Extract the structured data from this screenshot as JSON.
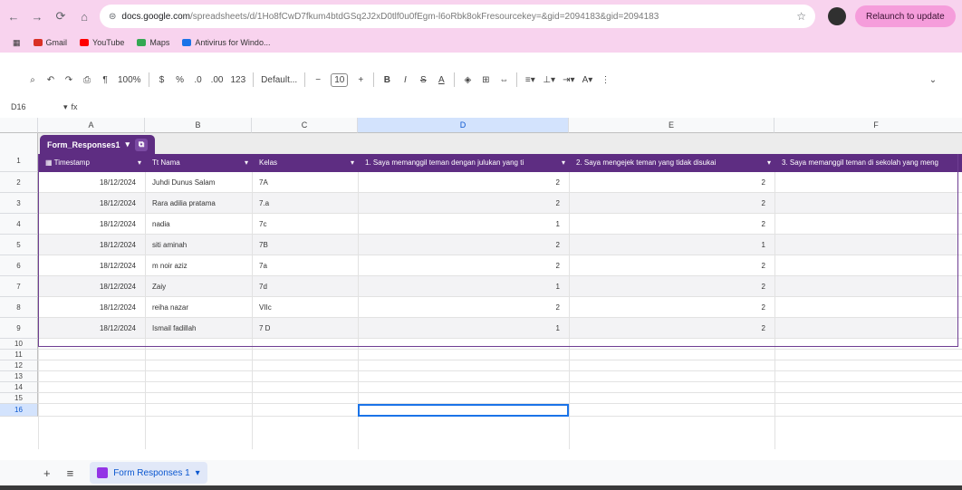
{
  "browser": {
    "url_domain": "docs.google.com",
    "url_path": "/spreadsheets/d/1Ho8fCwD7fkum4btdGSq2J2xD0tlf0u0fEgm-l6oRbk8okFresourcekey=&gid=2094183&gid=2094183",
    "relaunch_label": "Relaunch to update",
    "bookmarks": [
      {
        "label": "Gmail",
        "color": "#d93025"
      },
      {
        "label": "YouTube",
        "color": "#ff0000"
      },
      {
        "label": "Maps",
        "color": "#34a853"
      },
      {
        "label": "Antivirus for Windo...",
        "color": "#1a73e8"
      }
    ]
  },
  "toolbar": {
    "zoom": "100%",
    "font": "Default...",
    "font_size": "10",
    "bold": "B",
    "italic": "I",
    "strike": "S",
    "underline_a": "A",
    "collapse": "⌄"
  },
  "formula_bar": {
    "name_box": "D16",
    "fx": "fx"
  },
  "columns": [
    "A",
    "B",
    "C",
    "D",
    "E",
    "F"
  ],
  "selected_column": "D",
  "row_numbers": [
    "1",
    "2",
    "3",
    "4",
    "5",
    "6",
    "7",
    "8",
    "9",
    "10",
    "11",
    "12",
    "13",
    "14",
    "15",
    "16"
  ],
  "selected_row": "16",
  "table": {
    "name": "Form_Responses1",
    "headers": [
      "Timestamp",
      "Nama",
      "Kelas",
      "1. Saya memanggil teman dengan julukan yang ti",
      "2. Saya mengejek teman yang tidak disukai",
      "3. Saya memanggil teman di sekolah yang meng"
    ],
    "rows": [
      {
        "timestamp": "18/12/2024",
        "nama": "Juhdi Dunus Salam",
        "kelas": "7A",
        "q1": "2",
        "q2": "2"
      },
      {
        "timestamp": "18/12/2024",
        "nama": "Rara adilia pratama",
        "kelas": "7.a",
        "q1": "2",
        "q2": "2"
      },
      {
        "timestamp": "18/12/2024",
        "nama": "nadia",
        "kelas": "7c",
        "q1": "1",
        "q2": "2"
      },
      {
        "timestamp": "18/12/2024",
        "nama": "siti aminah",
        "kelas": "7B",
        "q1": "2",
        "q2": "1"
      },
      {
        "timestamp": "18/12/2024",
        "nama": "m noir aziz",
        "kelas": "7a",
        "q1": "2",
        "q2": "2"
      },
      {
        "timestamp": "18/12/2024",
        "nama": "Zaiy",
        "kelas": "7d",
        "q1": "1",
        "q2": "2"
      },
      {
        "timestamp": "18/12/2024",
        "nama": "reiha nazar",
        "kelas": "VIIc",
        "q1": "2",
        "q2": "2"
      },
      {
        "timestamp": "18/12/2024",
        "nama": "Ismail fadillah",
        "kelas": "7 D",
        "q1": "1",
        "q2": "2"
      }
    ]
  },
  "sheet_tabs": {
    "add": "+",
    "all": "≡",
    "active": "Form Responses 1"
  },
  "colors": {
    "table_header": "#5e2d82",
    "browser_chrome": "#f8d3ee",
    "selection": "#1a73e8"
  }
}
